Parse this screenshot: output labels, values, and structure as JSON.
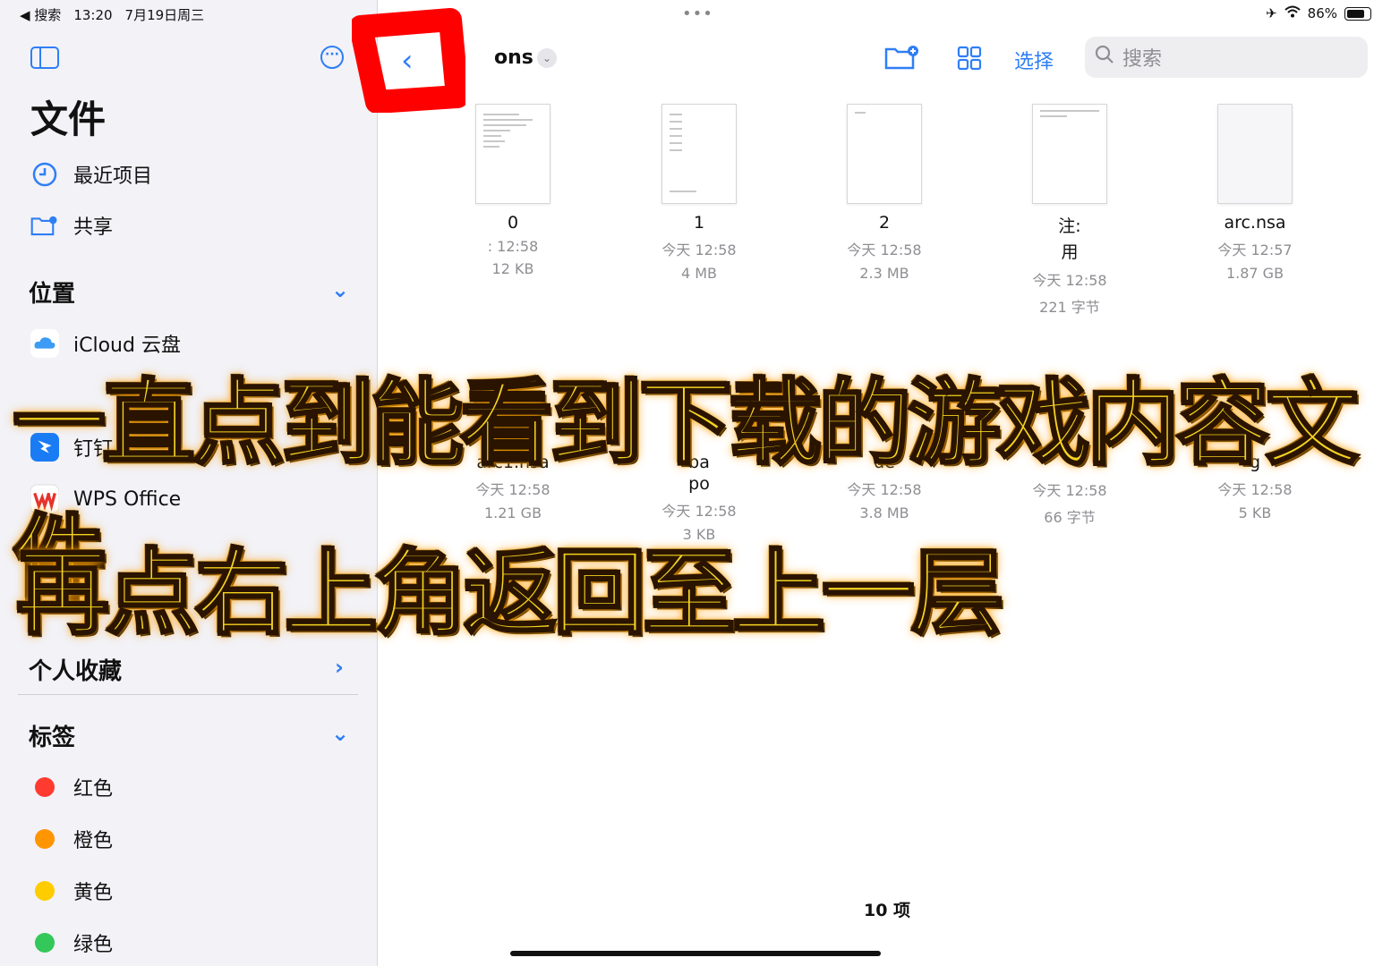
{
  "status_bar": {
    "back_app": "◀ 搜索",
    "time": "13:20",
    "date": "7月19日周三",
    "battery": "86%",
    "battery_level": 0.86
  },
  "sidebar": {
    "title": "文件",
    "items": [
      {
        "label": "最近项目",
        "icon": "clock-icon"
      },
      {
        "label": "共享",
        "icon": "shared-folder-icon"
      }
    ],
    "locations_title": "位置",
    "locations": [
      {
        "label": "iCloud 云盘",
        "icon": "icloud-icon"
      },
      {
        "label": "钉钉",
        "icon": "dingtalk-icon"
      },
      {
        "label": "WPS Office",
        "icon": "wps-icon"
      }
    ],
    "favorites_title": "个人收藏",
    "tags_title": "标签",
    "tags": [
      {
        "label": "红色",
        "color": "#ff3b30"
      },
      {
        "label": "橙色",
        "color": "#ff9500"
      },
      {
        "label": "黄色",
        "color": "#ffcc00"
      },
      {
        "label": "绿色",
        "color": "#34c759"
      }
    ]
  },
  "toolbar": {
    "folder_name": "ons",
    "select_label": "选择",
    "search_placeholder": "搜索"
  },
  "files": [
    {
      "name": "0",
      "date": ": 12:58",
      "size": "12 KB"
    },
    {
      "name": "1",
      "date": "今天 12:58",
      "size": "4 MB"
    },
    {
      "name": "2",
      "date": "今天 12:58",
      "size": "2.3 MB"
    },
    {
      "name": "注:",
      "name2": "用",
      "date": "今天 12:58",
      "size": "221 字节"
    },
    {
      "name": "arc.nsa",
      "date": "今天 12:57",
      "size": "1.87 GB"
    },
    {
      "name": "arc1.nsa",
      "date": "今天 12:58",
      "size": "1.21 GB"
    },
    {
      "name": "ba",
      "name2": "po",
      "date": "今天 12:58",
      "size": "3 KB"
    },
    {
      "name": "de",
      "date": "今天 12:58",
      "size": "3.8 MB"
    },
    {
      "name": "",
      "date": "今天 12:58",
      "size": "66 字节"
    },
    {
      "name": "g",
      "date": "今天 12:58",
      "size": "5 KB"
    }
  ],
  "item_count": "10 项",
  "captions": {
    "line1": "一直点到能看到下载的游戏内容文件",
    "line2": "再点右上角返回至上一层"
  }
}
